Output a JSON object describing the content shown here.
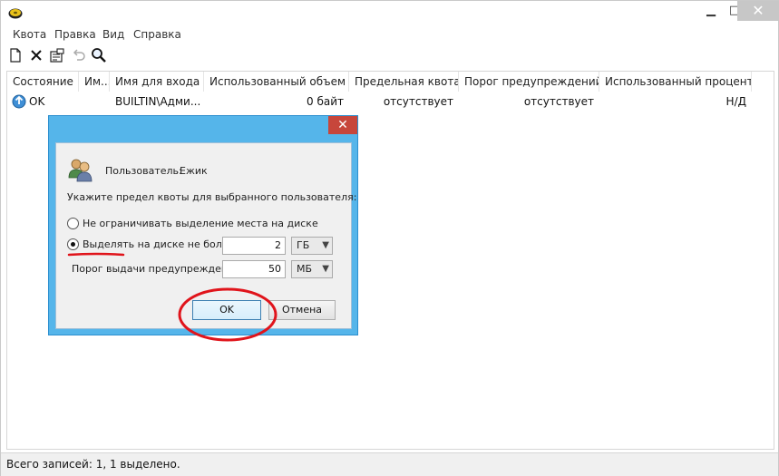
{
  "menu": [
    "Квота",
    "Правка",
    "Вид",
    "Справка"
  ],
  "columns": [
    "Состояние",
    "Им...",
    "Имя для входа",
    "Использованный объем",
    "Предельная квота",
    "Порог предупреждений",
    "Использованный процент"
  ],
  "row": {
    "status": "OK",
    "name": "",
    "login": "BUILTIN\\Адми...",
    "used": "0 байт",
    "limit": "отсутствует",
    "warning": "отсутствует",
    "percent": "Н/Д"
  },
  "status_bar": "Всего записей: 1, 1 выделено.",
  "dialog": {
    "close_glyph": "✕",
    "user_label": "Пользователь:",
    "user_name": "Ежик",
    "instruction": "Укажите предел квоты для выбранного пользователя:",
    "option_unlimited": "Не ограничивать выделение места на диске",
    "option_limit": "Выделять на диске не более",
    "limit_value": "2",
    "limit_unit": "ГБ",
    "warning_label": "Порог выдачи предупреждений",
    "warning_value": "50",
    "warning_unit": "МБ",
    "ok_label": "OK",
    "cancel_label": "Отмена"
  },
  "icons": {
    "app": "disk-icon",
    "new": "new-document-icon",
    "delete": "delete-x-icon",
    "properties": "properties-icon",
    "undo": "undo-icon",
    "find": "magnifier-icon",
    "status": "ok-status-icon",
    "user": "users-icon"
  },
  "colors": {
    "dialog_frame": "#55b5ea",
    "close_button": "#c7463b",
    "annotation": "#e0141b"
  }
}
